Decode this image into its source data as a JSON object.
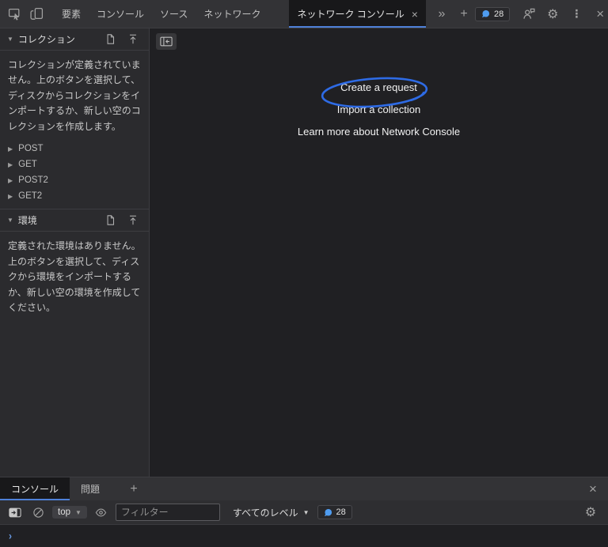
{
  "colors": {
    "accent_blue": "#4e80d8",
    "annotation_blue": "#2e6be5",
    "bubble_blue": "#4f9cf0"
  },
  "top_toolbar": {
    "tabs": [
      "要素",
      "コンソール",
      "ソース",
      "ネットワーク"
    ],
    "active_tab": "ネットワーク コンソール",
    "issues_badge": "28"
  },
  "sidebar": {
    "collections": {
      "title": "コレクション",
      "description": "コレクションが定義されていません。上のボタンを選択して、ディスクからコレクションをインポートするか、新しい空のコレクションを作成します。",
      "items": [
        "POST",
        "GET",
        "POST2",
        "GET2"
      ]
    },
    "environment": {
      "title": "環境",
      "description": "定義された環境はありません。上のボタンを選択して、ディスクから環境をインポートするか、新しい空の環境を作成してください。"
    }
  },
  "main": {
    "links": [
      "Create a request",
      "Import a collection",
      "Learn more about Network Console"
    ]
  },
  "console_drawer": {
    "tabs": [
      "コンソール",
      "問題"
    ],
    "context_selector": "top",
    "filter_placeholder": "フィルター",
    "level_selector": "すべてのレベル",
    "issues_badge": "28",
    "prompt": "›"
  },
  "glyphs": {
    "collapse": "▼",
    "expand": "▶",
    "more_tabs": "»",
    "add": "+",
    "more_menu": "⋮",
    "close": "×",
    "dropdown": "▼",
    "gear": "⚙"
  }
}
